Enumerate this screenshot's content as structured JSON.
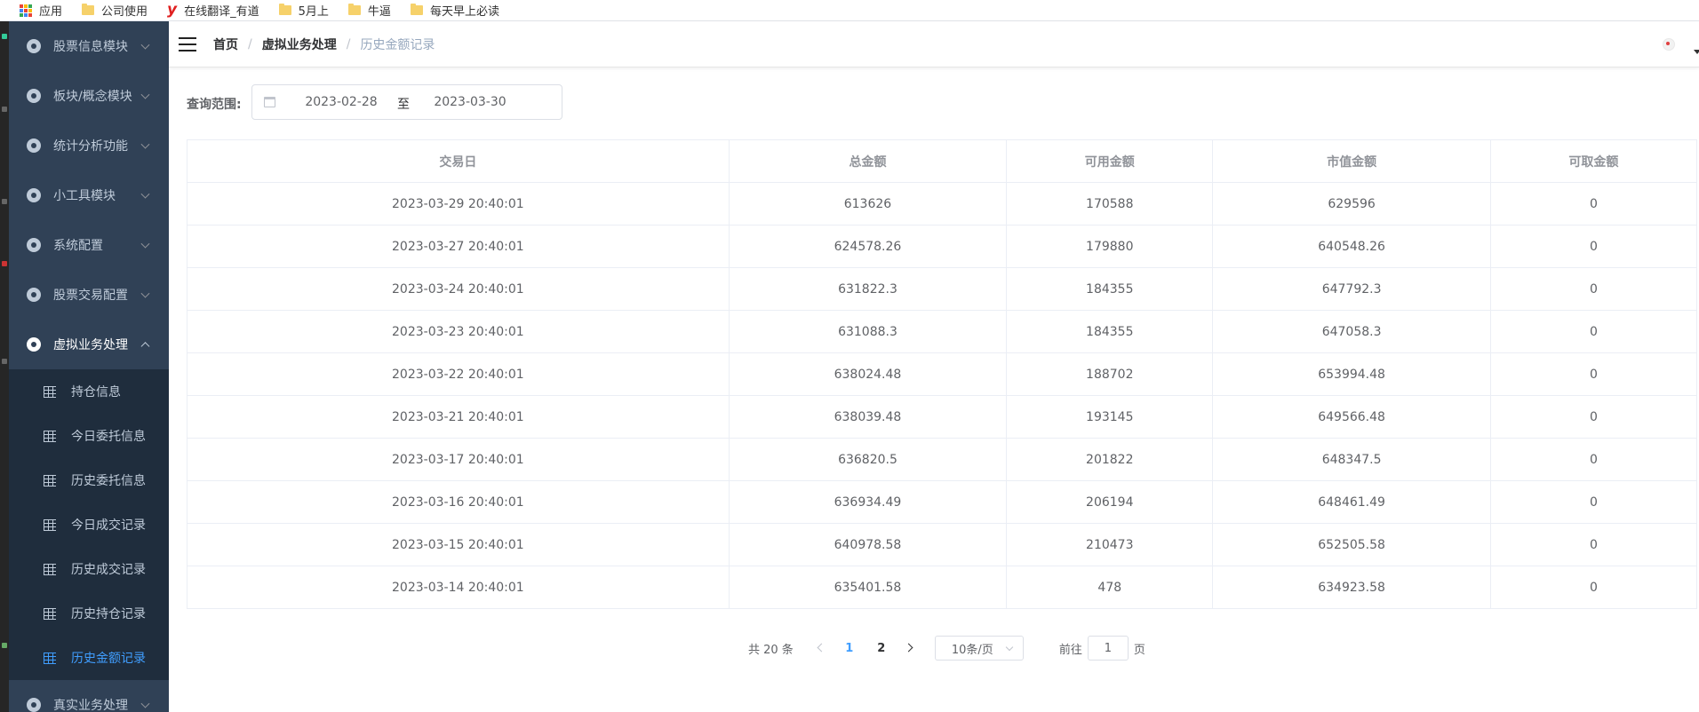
{
  "bookmarks": [
    {
      "icon": "apps-grid-icon",
      "label": "应用"
    },
    {
      "icon": "folder-icon",
      "label": "公司使用"
    },
    {
      "icon": "youdao-icon",
      "label": "在线翻译_有道"
    },
    {
      "icon": "folder-icon",
      "label": "5月上"
    },
    {
      "icon": "folder-icon",
      "label": "牛逼"
    },
    {
      "icon": "folder-icon",
      "label": "每天早上必读"
    }
  ],
  "sidebar": {
    "menus_top": [
      {
        "label": "股票信息模块"
      },
      {
        "label": "板块/概念模块"
      },
      {
        "label": "统计分析功能"
      },
      {
        "label": "小工具模块"
      },
      {
        "label": "系统配置"
      },
      {
        "label": "股票交易配置"
      }
    ],
    "open_menu": {
      "label": "虚拟业务处理"
    },
    "submenu": [
      {
        "label": "持仓信息"
      },
      {
        "label": "今日委托信息"
      },
      {
        "label": "历史委托信息"
      },
      {
        "label": "今日成交记录"
      },
      {
        "label": "历史成交记录"
      },
      {
        "label": "历史持仓记录"
      },
      {
        "label": "历史金额记录",
        "active": true
      }
    ],
    "menus_bottom": [
      {
        "label": "真实业务处理"
      }
    ]
  },
  "breadcrumb": {
    "home": "首页",
    "section": "虚拟业务处理",
    "current": "历史金额记录",
    "separator": "/"
  },
  "filter": {
    "label": "查询范围:",
    "start_date": "2023-02-28",
    "separator": "至",
    "end_date": "2023-03-30"
  },
  "table": {
    "columns": [
      "交易日",
      "总金额",
      "可用金额",
      "市值金额",
      "可取金额"
    ],
    "rows": [
      [
        "2023-03-29 20:40:01",
        "613626",
        "170588",
        "629596",
        "0"
      ],
      [
        "2023-03-27 20:40:01",
        "624578.26",
        "179880",
        "640548.26",
        "0"
      ],
      [
        "2023-03-24 20:40:01",
        "631822.3",
        "184355",
        "647792.3",
        "0"
      ],
      [
        "2023-03-23 20:40:01",
        "631088.3",
        "184355",
        "647058.3",
        "0"
      ],
      [
        "2023-03-22 20:40:01",
        "638024.48",
        "188702",
        "653994.48",
        "0"
      ],
      [
        "2023-03-21 20:40:01",
        "638039.48",
        "193145",
        "649566.48",
        "0"
      ],
      [
        "2023-03-17 20:40:01",
        "636820.5",
        "201822",
        "648347.5",
        "0"
      ],
      [
        "2023-03-16 20:40:01",
        "636934.49",
        "206194",
        "648461.49",
        "0"
      ],
      [
        "2023-03-15 20:40:01",
        "640978.58",
        "210473",
        "652505.58",
        "0"
      ],
      [
        "2023-03-14 20:40:01",
        "635401.58",
        "478",
        "634923.58",
        "0"
      ]
    ]
  },
  "pagination": {
    "total": "共 20 条",
    "pages": [
      "1",
      "2"
    ],
    "current_page": "1",
    "page_size": "10条/页",
    "goto_label": "前往",
    "goto_value": "1",
    "goto_suffix": "页"
  },
  "colors": {
    "sidebar_bg": "#304156",
    "submenu_bg": "#1f2d3d",
    "active": "#409eff"
  }
}
